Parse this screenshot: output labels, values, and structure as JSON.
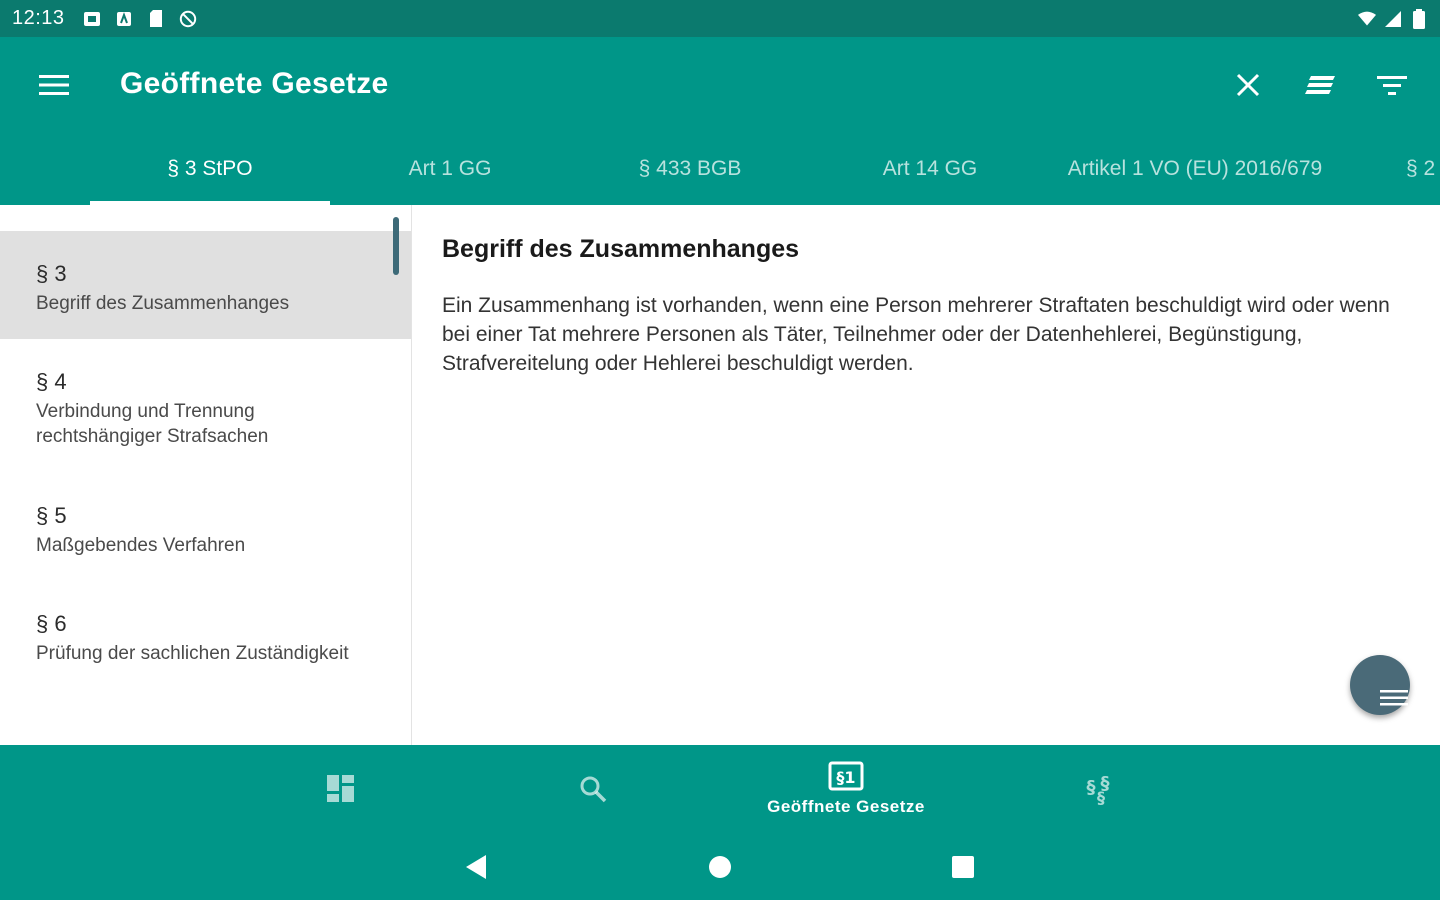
{
  "status_bar": {
    "time": "12:13"
  },
  "app_bar": {
    "title": "Geöffnete Gesetze"
  },
  "tabs": [
    {
      "label": "§ 3 StPO",
      "active": true
    },
    {
      "label": "Art 1 GG"
    },
    {
      "label": "§ 433 BGB"
    },
    {
      "label": "Art 14 GG"
    },
    {
      "label": "Artikel 1 VO (EU) 2016/679"
    },
    {
      "label": "§ 2"
    }
  ],
  "sidebar": {
    "items": [
      {
        "number": "§ 3",
        "title": "Begriff des Zusammenhanges",
        "selected": true
      },
      {
        "number": "§ 4",
        "title": "Verbindung und Trennung rechtshängiger Strafsachen"
      },
      {
        "number": "§ 5",
        "title": "Maßgebendes Verfahren"
      },
      {
        "number": "§ 6",
        "title": "Prüfung der sachlichen Zuständigkeit"
      }
    ]
  },
  "content": {
    "title": "Begriff des Zusammenhanges",
    "body": "Ein Zusammenhang ist vorhanden, wenn eine Person mehrerer Straftaten beschuldigt wird oder wenn bei einer Tat mehrere Personen als Täter, Teilnehmer oder der Datenhehlerei, Begünstigung, Strafvereitelung oder Hehlerei beschuldigt werden."
  },
  "bottom_nav": {
    "items": [
      {
        "icon": "dashboard-icon",
        "label": ""
      },
      {
        "icon": "search-icon",
        "label": ""
      },
      {
        "icon": "open-laws-icon",
        "label": "Geöffnete Gesetze",
        "active": true
      },
      {
        "icon": "paragraph-icon",
        "label": ""
      }
    ]
  },
  "colors": {
    "primary": "#009688",
    "status_bar": "#0b7a6e",
    "selected_item": "#e0e0e0",
    "fab": "#4a6a78"
  }
}
